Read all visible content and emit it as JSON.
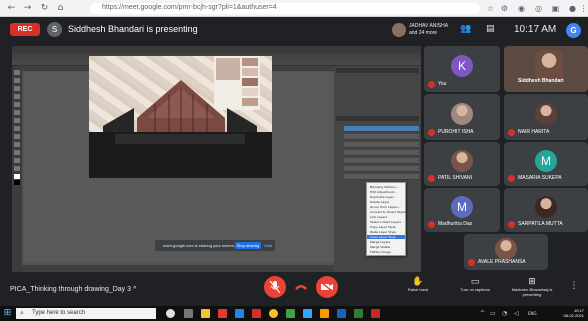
{
  "browser": {
    "url": "https://meet.google.com/pmr-bcjh-sgr?pli=1&authuser=4",
    "back_icon": "arrow-left-icon",
    "forward_icon": "arrow-right-icon",
    "reload_icon": "reload-icon"
  },
  "meet_header": {
    "rec_label": "REC",
    "presenter_initial": "S",
    "presenting_text": "Siddhesh Bhandari is presenting",
    "you_chip_line1": "JADHAV ANISHA",
    "you_chip_line2": "and 24 more",
    "clock": "10:17 AM",
    "my_initial": "G"
  },
  "context_menu": {
    "items": [
      "Blending Options...",
      "Edit Adjustment...",
      "Duplicate Layer...",
      "Delete Layer",
      "Group from Layers...",
      "Convert to Smart Object",
      "Link Layers",
      "Select Linked Layers",
      "Copy Layer Style",
      "Paste Layer Style",
      "Clear Layer Style",
      "Merge Layers",
      "Merge Visible",
      "Flatten Image"
    ],
    "selected_index": 10
  },
  "share_bar": {
    "message": "meet.google.com is sharing your screen.",
    "stop_label": "Stop sharing",
    "hide_label": "Hide"
  },
  "participants": [
    {
      "name": "Siddhesh Bhandari",
      "kind": "photo",
      "muted": false
    },
    {
      "name": "You",
      "kind": "initial",
      "initial": "K",
      "color": "#7e57c2",
      "muted": true
    },
    {
      "name": "PUROHIT ISHA",
      "kind": "photo",
      "muted": true
    },
    {
      "name": "NAIR HARITA",
      "kind": "photo",
      "muted": true
    },
    {
      "name": "PATIL SHIVANI",
      "kind": "photo",
      "muted": true
    },
    {
      "name": "MASARIA SUKEPA",
      "kind": "initial",
      "initial": "M",
      "color": "#26a69a",
      "muted": true
    },
    {
      "name": "Madhuritra Das",
      "kind": "initial",
      "initial": "M",
      "color": "#5c6bc0",
      "muted": true
    },
    {
      "name": "SARPATILA MUTTA",
      "kind": "photo",
      "muted": true
    },
    {
      "name": "AVALE PRASHANSA",
      "kind": "photo",
      "muted": true
    }
  ],
  "meet_bottom": {
    "meeting_title": "PICA_Thinking through drawing_Day 3",
    "chevron": "^",
    "raise_hand": "Raise hand",
    "turn_on_captions": "Turn on captions",
    "present_label": "Markmen Bharadwaj is presenting",
    "more_icon": "more-vert-icon"
  },
  "taskbar": {
    "search_placeholder": "Type here to search",
    "time": "10:17",
    "date": "08-02-2021",
    "lang": "ENG"
  },
  "colors": {
    "meet_bg": "#202124",
    "tile_bg": "#3c4043",
    "mute_red": "#d93025",
    "end_call": "#ea4335",
    "ps_bg": "#535353",
    "building_brick": "#7a4a42"
  }
}
